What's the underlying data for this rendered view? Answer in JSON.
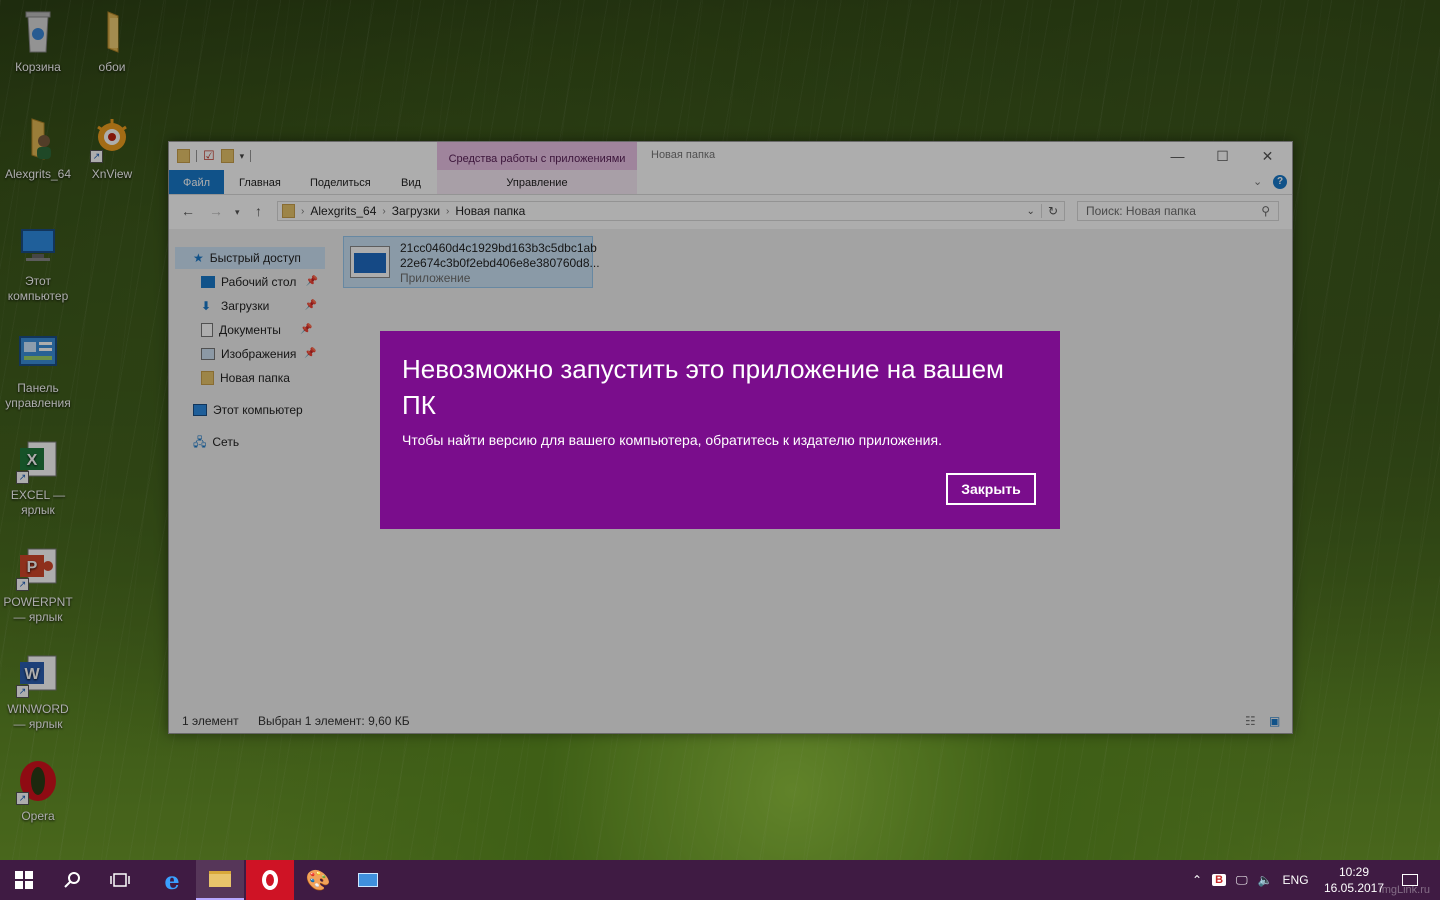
{
  "desktop": {
    "icons": [
      {
        "label": "Корзина"
      },
      {
        "label": "обои"
      },
      {
        "label": "Alexgrits_64"
      },
      {
        "label": "XnView"
      },
      {
        "label": "Этот компьютер"
      },
      {
        "label": "Панель управления"
      },
      {
        "label": "EXCEL — ярлык"
      },
      {
        "label": "POWERPNT — ярлык"
      },
      {
        "label": "WINWORD — ярлык"
      },
      {
        "label": "Opera"
      }
    ]
  },
  "explorer": {
    "title": "Новая папка",
    "context_tab_group": "Средства работы с приложениями",
    "ribbon_tabs": [
      "Файл",
      "Главная",
      "Поделиться",
      "Вид"
    ],
    "context_tab": "Управление",
    "breadcrumb": [
      "Alexgrits_64",
      "Загрузки",
      "Новая папка"
    ],
    "search_placeholder": "Поиск: Новая папка",
    "nav": {
      "quick_access": "Быстрый доступ",
      "items": [
        {
          "label": "Рабочий стол",
          "icon": "desktop-icon"
        },
        {
          "label": "Загрузки",
          "icon": "download-icon"
        },
        {
          "label": "Документы",
          "icon": "document-icon"
        },
        {
          "label": "Изображения",
          "icon": "pictures-icon"
        },
        {
          "label": "Новая папка",
          "icon": "folder-icon"
        }
      ],
      "this_pc": "Этот компьютер",
      "network": "Сеть"
    },
    "file": {
      "name_line1": "21cc0460d4c1929bd163b3c5dbc1ab",
      "name_line2": "22e674c3b0f2ebd406e8e380760d8...",
      "type": "Приложение"
    },
    "status": {
      "count": "1 элемент",
      "selected": "Выбран 1 элемент: 9,60 КБ"
    }
  },
  "dialog": {
    "title": "Невозможно запустить это приложение на вашем ПК",
    "message": "Чтобы найти версию для вашего компьютера, обратитесь к издателю приложения.",
    "close_button": "Закрыть",
    "bg_color": "#7a0d8c"
  },
  "taskbar": {
    "language": "ENG",
    "time": "10:29",
    "date": "16.05.2017"
  },
  "watermark": "ImgLink.ru"
}
